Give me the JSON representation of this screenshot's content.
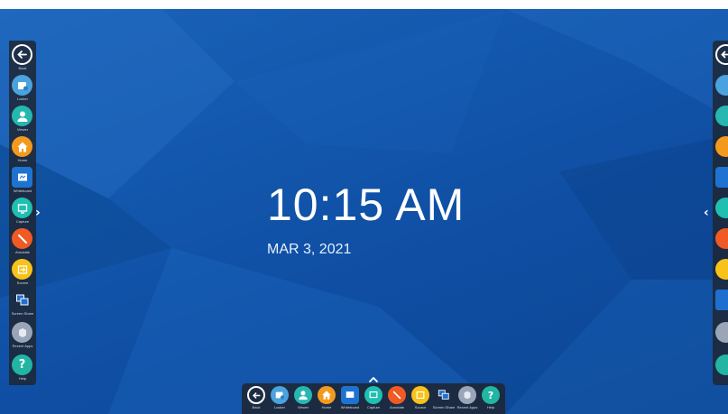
{
  "clock": {
    "time": "10:15 AM",
    "date": "MAR 3, 2021"
  },
  "colors": {
    "back": "#2a2f3a",
    "locker": "#4aa3df",
    "viewer": "#26b7b0",
    "home": "#f39a1e",
    "whiteboard": "#1e73d2",
    "capture": "#1fbfb2",
    "annotate": "#f05a24",
    "source": "#f7c21a",
    "screenshare": "#1e6fd0",
    "recentapps": "#9aa6b8",
    "help": "#22b5a4"
  },
  "toolbar": {
    "items": [
      {
        "key": "back",
        "label": "Back",
        "icon": "back-arrow-icon"
      },
      {
        "key": "locker",
        "label": "Locker",
        "icon": "locker-icon"
      },
      {
        "key": "viewer",
        "label": "Viewer",
        "icon": "user-icon"
      },
      {
        "key": "home",
        "label": "Home",
        "icon": "home-icon"
      },
      {
        "key": "whiteboard",
        "label": "Whiteboard",
        "icon": "whiteboard-icon"
      },
      {
        "key": "capture",
        "label": "Capture",
        "icon": "capture-icon"
      },
      {
        "key": "annotate",
        "label": "Annotate",
        "icon": "pen-icon"
      },
      {
        "key": "source",
        "label": "Source",
        "icon": "source-icon"
      },
      {
        "key": "screenshare",
        "label": "Screen Share",
        "icon": "screen-share-icon"
      },
      {
        "key": "recentapps",
        "label": "Recent Apps",
        "icon": "recent-apps-icon"
      },
      {
        "key": "help",
        "label": "Help",
        "icon": "help-icon"
      }
    ]
  }
}
